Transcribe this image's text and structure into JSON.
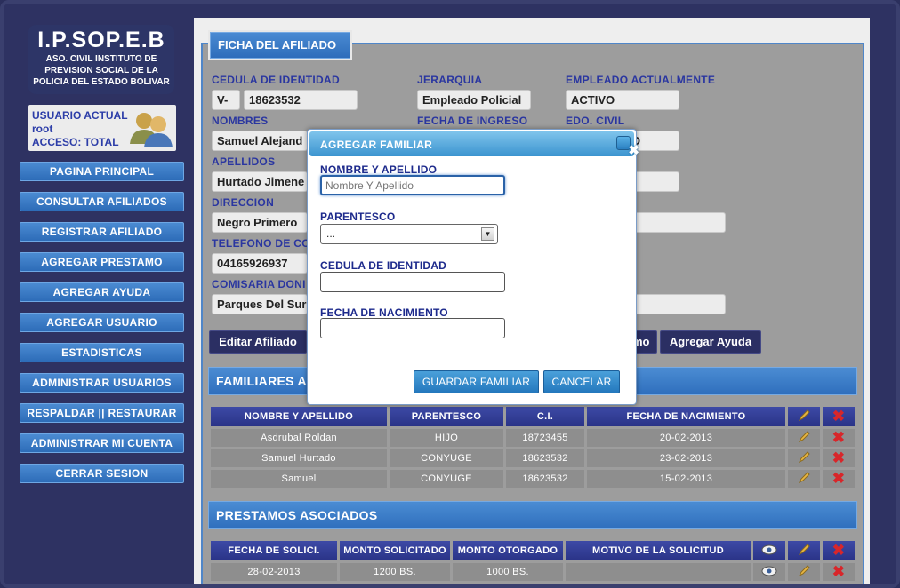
{
  "logo": {
    "title": "I.P.SOP.E.B",
    "subtitle": "ASO. CIVIL INSTITUTO DE PREVISION SOCIAL DE LA POLICIA DEL ESTADO BOLIVAR"
  },
  "user": {
    "line1": "USUARIO ACTUAL",
    "line2": "root",
    "line3": "ACCESO: TOTAL"
  },
  "nav": [
    "PAGINA PRINCIPAL",
    "CONSULTAR AFILIADOS",
    "REGISTRAR AFILIADO",
    "AGREGAR PRESTAMO",
    "AGREGAR AYUDA",
    "AGREGAR USUARIO",
    "ESTADISTICAS",
    "ADMINISTRAR USUARIOS",
    "RESPALDAR || RESTAURAR",
    "ADMINISTRAR MI CUENTA",
    "CERRAR SESION"
  ],
  "ficha": {
    "title": "FICHA DEL AFILIADO",
    "cedula_label": "CEDULA DE IDENTIDAD",
    "cedula_prefix": "V-",
    "cedula_value": "18623532",
    "jerarquia_label": "JERARQUIA",
    "jerarquia_value": "Empleado Policial",
    "empleado_label": "EMPLEADO ACTUALMENTE",
    "empleado_value": "ACTIVO",
    "nombres_label": "NOMBRES",
    "nombres_value": "Samuel Alejand",
    "ingreso_label": "FECHA DE INGRESO",
    "civil_label": "EDO. CIVIL",
    "civil_value": "O",
    "apellidos_label": "APELLIDOS",
    "apellidos_value": "Hurtado Jimene",
    "direccion_label": "DIRECCION",
    "direccion_value": "Negro Primero",
    "telefono_label": "TELEFONO DE CO",
    "telefono_value": "04165926937",
    "comisaria_label": "COMISARIA DONI",
    "comisaria_value": "Parques Del Sur",
    "btn_editar": "Editar Afiliado",
    "btn_prestamo_tail": "mo",
    "btn_ayuda": "Agregar Ayuda"
  },
  "familiares": {
    "title": "FAMILIARES AF",
    "headers": [
      "NOMBRE Y APELLIDO",
      "PARENTESCO",
      "C.I.",
      "FECHA DE NACIMIENTO"
    ],
    "rows": [
      [
        "Asdrubal Roldan",
        "HIJO",
        "18723455",
        "20-02-2013"
      ],
      [
        "Samuel Hurtado",
        "CONYUGE",
        "18623532",
        "23-02-2013"
      ],
      [
        "Samuel",
        "CONYUGE",
        "18623532",
        "15-02-2013"
      ]
    ]
  },
  "prestamos": {
    "title": "PRESTAMOS ASOCIADOS",
    "headers": [
      "FECHA DE SOLICI.",
      "MONTO SOLICITADO",
      "MONTO OTORGADO",
      "MOTIVO DE LA SOLICITUD"
    ],
    "rows": [
      [
        "28-02-2013",
        "1200 BS.",
        "1000 BS.",
        ""
      ]
    ]
  },
  "modal": {
    "title": "AGREGAR FAMILIAR",
    "nombre_label": "NOMBRE Y APELLIDO",
    "nombre_placeholder": "Nombre Y Apellido",
    "parentesco_label": "PARENTESCO",
    "parentesco_value": "...",
    "cedula_label": "CEDULA DE IDENTIDAD",
    "nacimiento_label": "FECHA DE NACIMIENTO",
    "btn_guardar": "GUARDAR FAMILIAR",
    "btn_cancelar": "CANCELAR"
  },
  "colors": {
    "accent": "#3a7cc6",
    "panel": "#9d9d9d",
    "sidebar": "#2e3262",
    "delete": "#d8262a"
  }
}
